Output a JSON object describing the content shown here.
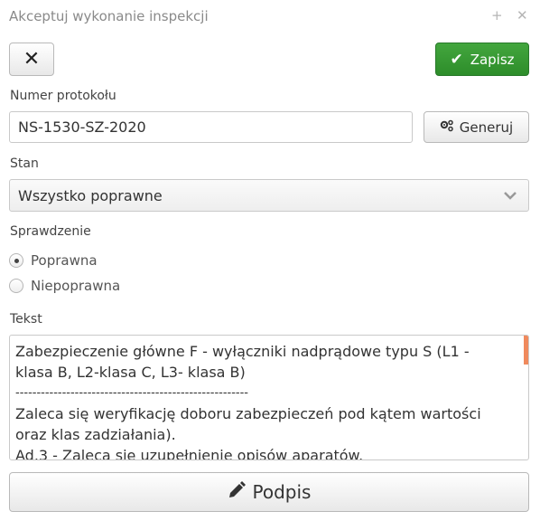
{
  "window": {
    "title": "Akceptuj wykonanie inspekcji",
    "icons": {
      "maximize": "plus-icon",
      "close": "close-icon"
    }
  },
  "toolbar": {
    "close_icon": "close-icon",
    "save_label": "Zapisz",
    "save_icon": "check-icon",
    "save_color": "#3a9b36"
  },
  "protocol": {
    "label": "Numer protokołu",
    "value": "NS-1530-SZ-2020",
    "generate_label": "Generuj",
    "generate_icon": "gears-icon"
  },
  "state": {
    "label": "Stan",
    "selected": "Wszystko poprawne"
  },
  "check": {
    "label": "Sprawdzenie",
    "options": [
      {
        "label": "Poprawna",
        "checked": true
      },
      {
        "label": "Niepoprawna",
        "checked": false
      }
    ]
  },
  "text": {
    "label": "Tekst",
    "lines": [
      "Zabezpieczenie główne F - wyłączniki nadprądowe typu S (L1 - klasa B, L2-klasa C, L3- klasa B)",
      "-------------------------------------------------------",
      "Zaleca się weryfikację doboru zabezpieczeń pod kątem wartości oraz klas zadziałania).",
      "Ad.3 - Zaleca się uzupełnienie opisów aparatów."
    ],
    "scrollbar_color": "#f08a5d"
  },
  "sign": {
    "label": "Podpis",
    "icon": "pencil-icon"
  }
}
